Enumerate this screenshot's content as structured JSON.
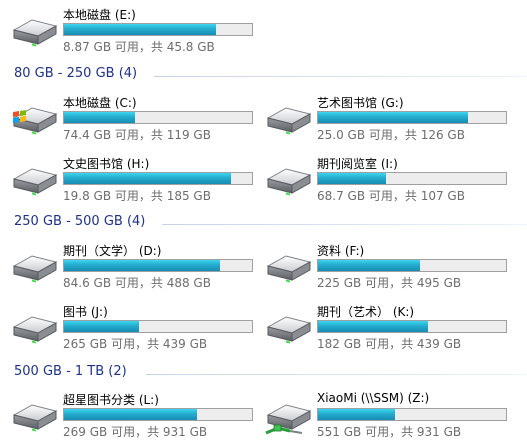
{
  "colors": {
    "group_header_text": "#1e3287",
    "bar_fill": "#26afd0",
    "bar_empty": "#ededed",
    "space_text": "#6d6d6d"
  },
  "groups": [
    {
      "title": "80 GB - 250 GB (4)"
    },
    {
      "title": "250 GB - 500 GB (4)"
    },
    {
      "title": "500 GB - 1 TB (2)"
    }
  ],
  "drives": {
    "e": {
      "name": "本地磁盘 (E:)",
      "space": "8.87 GB 可用，共 45.8 GB",
      "used_fraction": 0.806,
      "icon": "hard-drive-icon"
    },
    "c": {
      "name": "本地磁盘 (C:)",
      "space": "74.4 GB 可用，共 119 GB",
      "used_fraction": 0.375,
      "icon": "windows-system-drive-icon"
    },
    "g": {
      "name": "艺术图书馆 (G:)",
      "space": "25.0 GB 可用，共 126 GB",
      "used_fraction": 0.8,
      "icon": "hard-drive-icon"
    },
    "h": {
      "name": "文史图书馆 (H:)",
      "space": "19.8 GB 可用，共 185 GB",
      "used_fraction": 0.89,
      "icon": "hard-drive-icon"
    },
    "i": {
      "name": "期刊阅览室 (I:)",
      "space": "68.7 GB 可用，共 107 GB",
      "used_fraction": 0.36,
      "icon": "hard-drive-icon"
    },
    "d": {
      "name": "期刊（文学） (D:)",
      "space": "84.6 GB 可用，共 488 GB",
      "used_fraction": 0.83,
      "icon": "hard-drive-icon"
    },
    "f": {
      "name": "资料 (F:)",
      "space": "225 GB 可用，共 495 GB",
      "used_fraction": 0.545,
      "icon": "hard-drive-icon"
    },
    "j": {
      "name": "图书 (J:)",
      "space": "265 GB 可用，共 439 GB",
      "used_fraction": 0.4,
      "icon": "hard-drive-icon"
    },
    "k": {
      "name": "期刊（艺术） (K:)",
      "space": "182 GB 可用，共 439 GB",
      "used_fraction": 0.585,
      "icon": "hard-drive-icon"
    },
    "l": {
      "name": "超星图书分类 (L:)",
      "space": "269 GB 可用，共 931 GB",
      "used_fraction": 0.71,
      "icon": "hard-drive-icon"
    },
    "z": {
      "name": "XiaoMi (\\\\SSM) (Z:)",
      "space": "551 GB 可用，共 931 GB",
      "used_fraction": 0.41,
      "icon": "network-drive-icon"
    }
  }
}
